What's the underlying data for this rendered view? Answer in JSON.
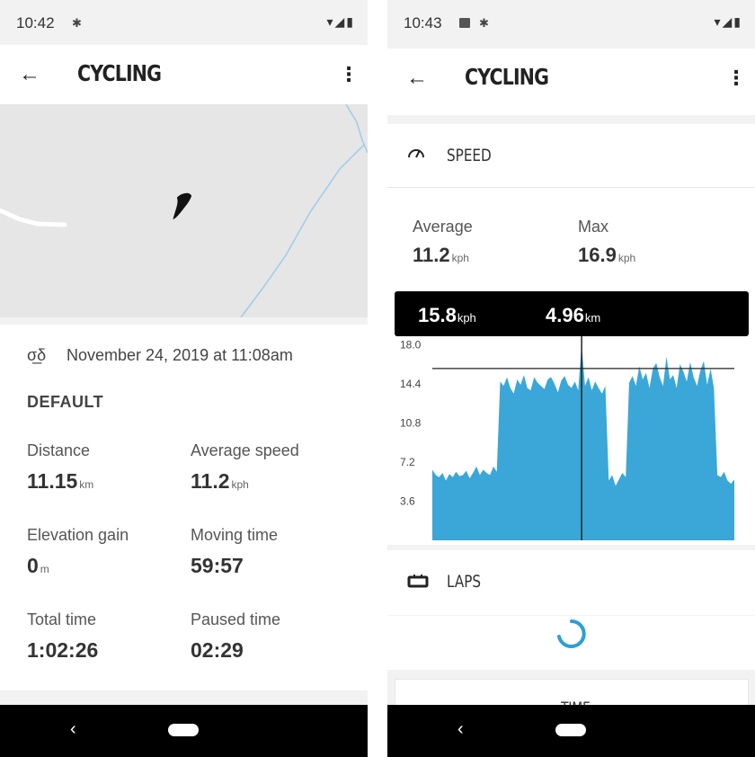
{
  "left": {
    "status": {
      "time": "10:42"
    },
    "appbar": {
      "title": "CYCLING"
    },
    "activity": {
      "date": "November 24, 2019 at 11:08am",
      "profile": "DEFAULT"
    },
    "stats": [
      {
        "label": "Distance",
        "value": "11.15",
        "unit": "km"
      },
      {
        "label": "Average speed",
        "value": "11.2",
        "unit": "kph"
      },
      {
        "label": "Elevation gain",
        "value": "0",
        "unit": "m"
      },
      {
        "label": "Moving time",
        "value": "59:57",
        "unit": ""
      },
      {
        "label": "Total time",
        "value": "1:02:26",
        "unit": ""
      },
      {
        "label": "Paused time",
        "value": "02:29",
        "unit": ""
      }
    ]
  },
  "right": {
    "status": {
      "time": "10:43"
    },
    "appbar": {
      "title": "CYCLING"
    },
    "speed": {
      "heading": "SPEED",
      "average_label": "Average",
      "average_value": "11.2",
      "average_unit": "kph",
      "max_label": "Max",
      "max_value": "16.9",
      "max_unit": "kph"
    },
    "tooltip": {
      "speed_value": "15.8",
      "speed_unit": "kph",
      "distance_value": "4.96",
      "distance_unit": "km"
    },
    "laps": {
      "heading": "LAPS"
    },
    "time_heading": "TIME"
  },
  "colors": {
    "chart_fill": "#3aa7d8",
    "map_water": "#9fcbe8",
    "tooltip_bg": "#000000",
    "spinner": "#2a9fd8"
  },
  "icons": [
    "back-arrow-icon",
    "overflow-menu-icon",
    "bicycle-icon",
    "speedometer-icon",
    "laps-icon",
    "bluetooth-icon",
    "wifi-icon",
    "signal-icon",
    "battery-icon",
    "image-icon"
  ],
  "chart_data": {
    "type": "area",
    "title": "",
    "xlabel": "",
    "ylabel": "",
    "ylim": [
      0,
      18.6
    ],
    "yticks": [
      "18.0",
      "14.4",
      "10.8",
      "7.2",
      "3.6"
    ],
    "ytick_values": [
      18.0,
      14.4,
      10.8,
      7.2,
      3.6
    ],
    "cursor": {
      "speed": 15.8,
      "distance": 4.96
    },
    "series": [
      {
        "values": [
          6.5,
          6.0,
          5.8,
          6.2,
          5.5,
          6.1,
          5.8,
          6.3,
          5.9,
          6.0,
          6.4,
          5.7,
          6.2,
          6.8,
          6.0,
          6.5,
          6.2,
          6.0,
          6.8,
          6.3,
          14.6,
          14.2,
          15.0,
          14.0,
          13.5,
          14.8,
          14.3,
          15.2,
          14.0,
          13.8,
          15.0,
          14.5,
          14.2,
          13.9,
          14.8,
          15.0,
          14.4,
          13.6,
          14.7,
          15.1,
          14.3,
          14.0,
          14.6,
          13.8,
          18.0,
          14.2,
          15.0,
          13.8,
          14.6,
          14.0,
          13.5,
          14.2,
          5.5,
          6.0,
          5.0,
          5.6,
          6.2,
          5.8,
          14.5,
          15.1,
          14.2,
          16.0,
          14.8,
          15.4,
          14.0,
          15.8,
          16.3,
          15.0,
          14.2,
          16.9,
          14.8,
          15.2,
          14.0,
          16.2,
          15.5,
          14.6,
          16.4,
          15.0,
          14.2,
          15.6,
          16.5,
          14.3,
          15.8,
          14.0,
          6.0,
          5.8,
          6.3,
          5.5,
          5.2,
          5.6
        ]
      }
    ]
  }
}
